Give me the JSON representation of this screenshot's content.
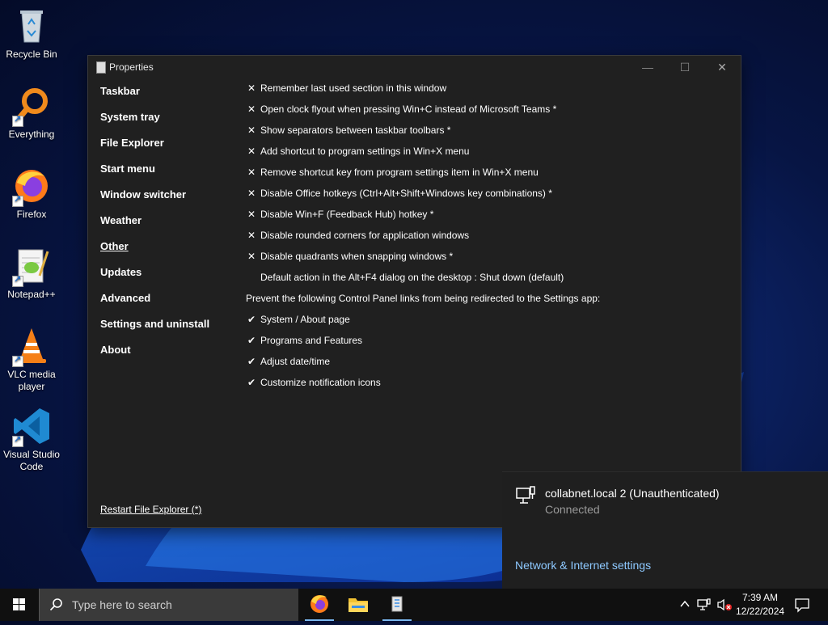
{
  "desktop": {
    "icons": [
      {
        "label": "Recycle Bin",
        "icon": "recycle-bin-icon"
      },
      {
        "label": "Everything",
        "icon": "everything-search-icon"
      },
      {
        "label": "Firefox",
        "icon": "firefox-icon"
      },
      {
        "label": "Notepad++",
        "icon": "notepad-plus-plus-icon"
      },
      {
        "label": "VLC media player",
        "icon": "vlc-icon"
      },
      {
        "label": "Visual Studio Code",
        "icon": "vscode-icon"
      }
    ]
  },
  "window": {
    "title": "Properties",
    "nav": [
      "Taskbar",
      "System tray",
      "File Explorer",
      "Start menu",
      "Window switcher",
      "Weather",
      "Other",
      "Updates",
      "Advanced",
      "Settings and uninstall",
      "About"
    ],
    "active_nav": "Other",
    "options": [
      {
        "mark": "✕",
        "label": "Remember last used section in this window"
      },
      {
        "mark": "✕",
        "label": "Open clock flyout when pressing Win+C instead of Microsoft Teams *"
      },
      {
        "mark": "✕",
        "label": "Show separators between taskbar toolbars *"
      },
      {
        "mark": "✕",
        "label": "Add shortcut to program settings in Win+X menu"
      },
      {
        "mark": "✕",
        "label": "Remove shortcut key from program settings item in Win+X menu"
      },
      {
        "mark": "✕",
        "label": "Disable Office hotkeys (Ctrl+Alt+Shift+Windows key combinations) *"
      },
      {
        "mark": "✕",
        "label": "Disable Win+F (Feedback Hub) hotkey *"
      },
      {
        "mark": "✕",
        "label": "Disable rounded corners for application windows"
      },
      {
        "mark": "✕",
        "label": "Disable quadrants when snapping windows *"
      },
      {
        "mark": "",
        "label": "Default action in the Alt+F4 dialog on the desktop : Shut down (default)"
      },
      {
        "mark": "none",
        "label": "Prevent the following Control Panel links from being redirected to the Settings app:"
      },
      {
        "mark": "✔",
        "label": "System / About page"
      },
      {
        "mark": "✔",
        "label": "Programs and Features"
      },
      {
        "mark": "✔",
        "label": "Adjust date/time"
      },
      {
        "mark": "✔",
        "label": "Customize notification icons"
      }
    ],
    "restart_link": "Restart File Explorer (*)"
  },
  "flyout": {
    "network_name": "collabnet.local 2 (Unauthenticated)",
    "status": "Connected",
    "settings_link": "Network & Internet settings"
  },
  "taskbar": {
    "search_placeholder": "Type here to search",
    "apps": [
      "firefox-icon",
      "file-explorer-icon",
      "properties-app-icon"
    ],
    "time": "7:39 AM",
    "date": "12/22/2024"
  },
  "colors": {
    "window_bg": "#202020",
    "link": "#8ec9ff",
    "taskbar_bg": "#101010"
  }
}
